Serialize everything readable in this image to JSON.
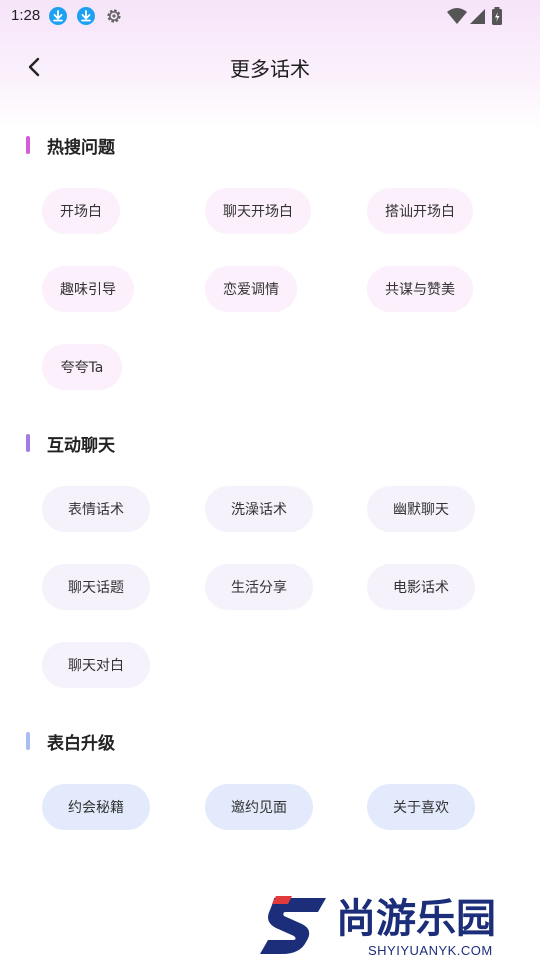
{
  "status_bar": {
    "time": "1:28",
    "icons": [
      "download-icon",
      "download-icon",
      "gear-icon",
      "wifi-icon",
      "signal-icon",
      "battery-icon"
    ]
  },
  "header": {
    "title": "更多话术"
  },
  "sections": [
    {
      "title": "热搜问题",
      "accent": "#d65bd8",
      "chip_color": "#fbf0fb",
      "items": [
        "开场白",
        "聊天开场白",
        "搭讪开场白",
        "趣味引导",
        "恋爱调情",
        "共谋与赞美",
        "夸夸Ta"
      ]
    },
    {
      "title": "互动聊天",
      "accent": "#a37ae6",
      "chip_color": "#f5f2fc",
      "items": [
        "表情话术",
        "洗澡话术",
        "幽默聊天",
        "聊天话题",
        "生活分享",
        "电影话术",
        "聊天对白"
      ]
    },
    {
      "title": "表白升级",
      "accent": "#a9bdf2",
      "chip_color": "#e2eafc",
      "items": [
        "约会秘籍",
        "邀约见面",
        "关于喜欢"
      ]
    }
  ],
  "watermark": {
    "brand": "尚游乐园",
    "url": "SHYIYUANYK.COM"
  }
}
